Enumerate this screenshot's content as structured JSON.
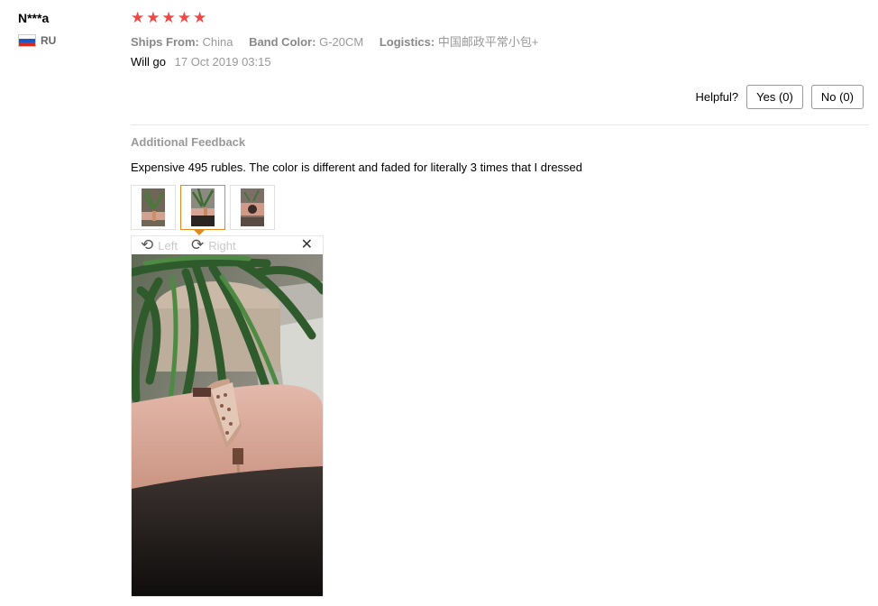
{
  "user": {
    "name": "N***a",
    "country": "RU",
    "flag_colors": [
      "#ffffff",
      "#1c57c6",
      "#d52b1e"
    ]
  },
  "review": {
    "rating": 5,
    "max_rating": 5,
    "star_color": "#f04747",
    "attributes": [
      {
        "key": "Ships From:",
        "value": "China"
      },
      {
        "key": "Band Color:",
        "value": "G-20CM"
      },
      {
        "key": "Logistics:",
        "value": "中国邮政平常小包+"
      }
    ],
    "text": "Will go",
    "date": "17 Oct 2019 03:15"
  },
  "helpful": {
    "label": "Helpful?",
    "yes_label": "Yes (0)",
    "no_label": "No (0)"
  },
  "additional": {
    "title": "Additional Feedback",
    "text": "Expensive 495 rubles. The color is different and faded for literally 3 times that I dressed",
    "thumbnails": [
      {
        "icon": "photo-thumbnail-1",
        "active": false
      },
      {
        "icon": "photo-thumbnail-2",
        "active": true
      },
      {
        "icon": "photo-thumbnail-3",
        "active": false
      }
    ],
    "active_color": "#e08a1e"
  },
  "viewer": {
    "rotate_left_label": "Left",
    "rotate_right_label": "Right",
    "rotate_left_icon": "rotate-left-icon",
    "rotate_right_icon": "rotate-right-icon",
    "close_icon": "close-icon"
  }
}
